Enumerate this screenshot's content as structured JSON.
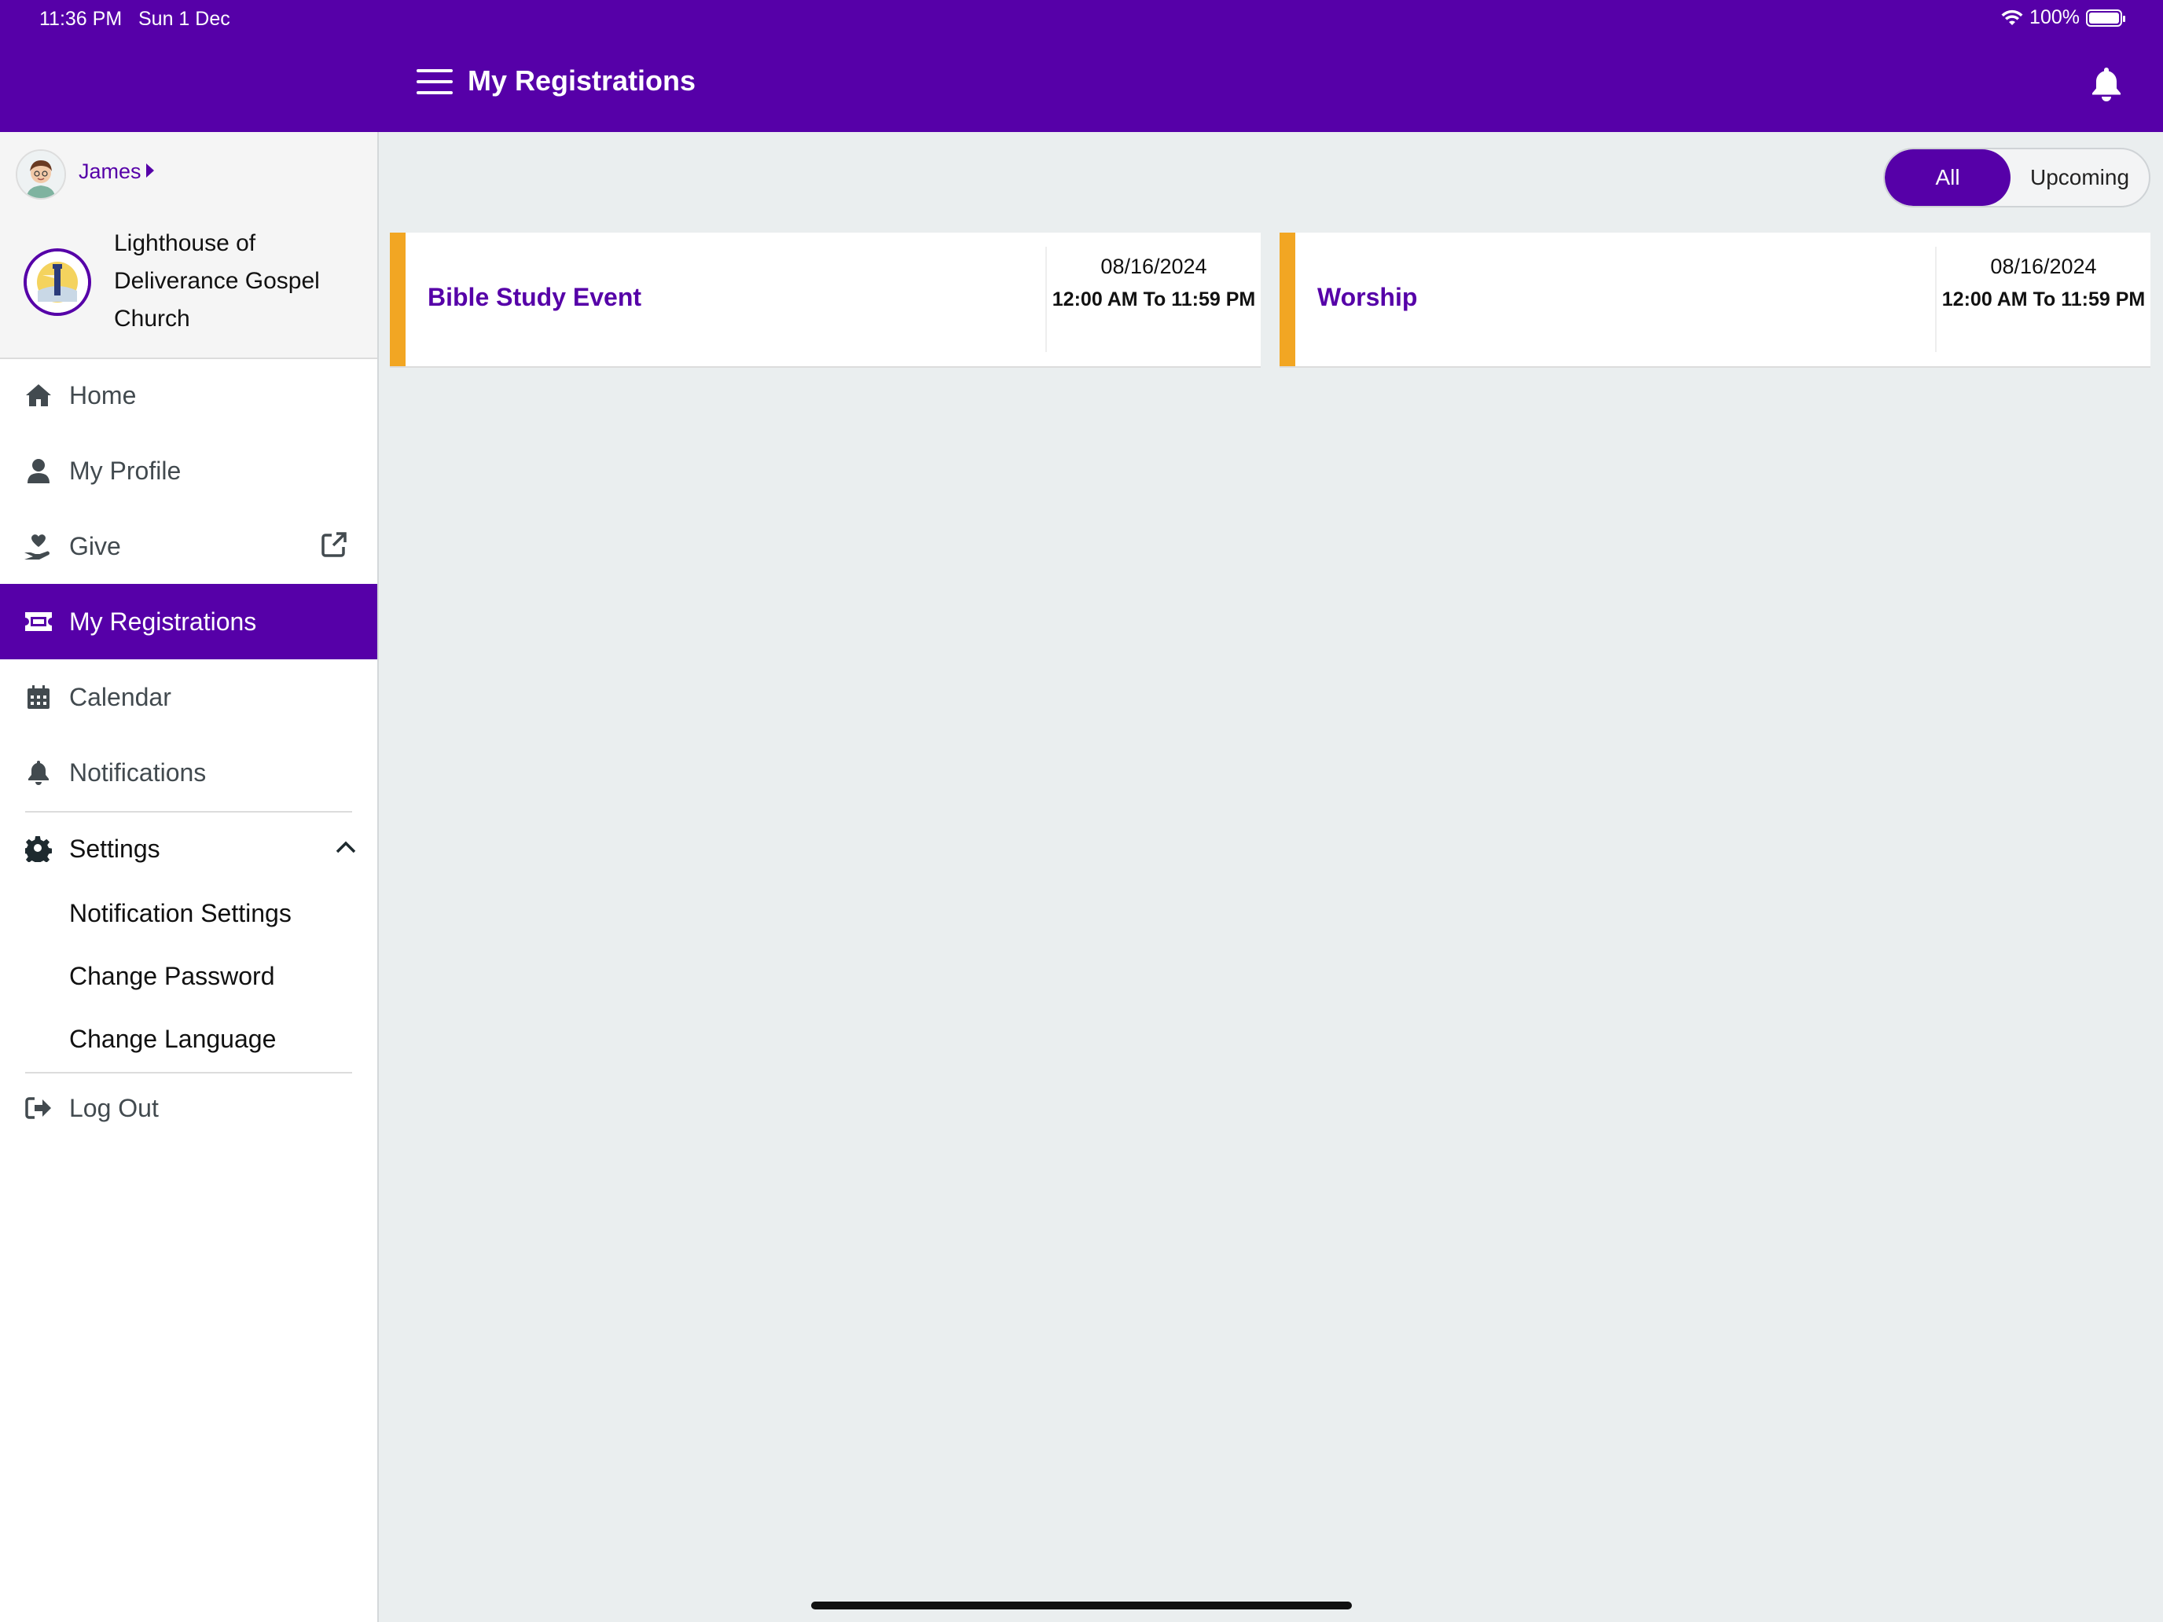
{
  "status_bar": {
    "time": "11:36 PM",
    "date": "Sun 1 Dec",
    "battery": "100%"
  },
  "header": {
    "title": "My Registrations"
  },
  "sidebar": {
    "user_name": "James",
    "church_name": "Lighthouse of Deliverance Gospel Church",
    "items": [
      {
        "label": "Home",
        "icon": "home-icon"
      },
      {
        "label": "My Profile",
        "icon": "user-icon"
      },
      {
        "label": "Give",
        "icon": "hand-heart-icon"
      },
      {
        "label": "My Registrations",
        "icon": "ticket-icon",
        "active": true
      },
      {
        "label": "Calendar",
        "icon": "calendar-icon"
      },
      {
        "label": "Notifications",
        "icon": "bell-icon"
      }
    ],
    "settings": {
      "label": "Settings",
      "expanded": true,
      "children": [
        "Notification Settings",
        "Change Password",
        "Change Language"
      ]
    },
    "logout_label": "Log Out"
  },
  "filter": {
    "options": [
      "All",
      "Upcoming"
    ],
    "selected": "All"
  },
  "registrations": [
    {
      "name": "Bible Study Event",
      "date": "08/16/2024",
      "time": "12:00 AM To 11:59 PM"
    },
    {
      "name": "Worship",
      "date": "08/16/2024",
      "time": "12:00 AM To 11:59 PM"
    }
  ],
  "colors": {
    "brand": "#5600a8",
    "accent": "#f2a623",
    "background": "#eaeeef"
  }
}
